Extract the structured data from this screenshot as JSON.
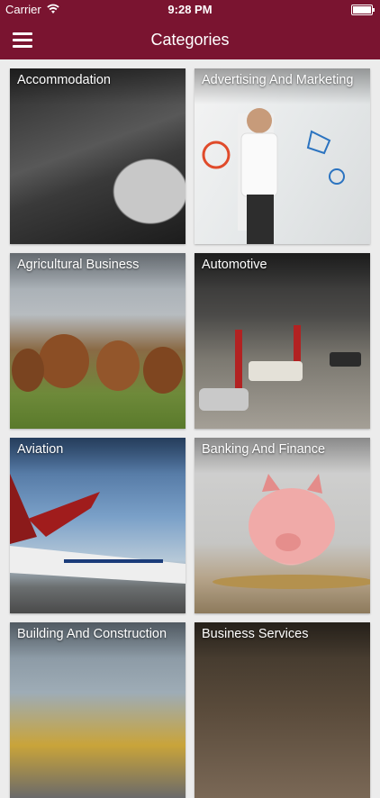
{
  "status_bar": {
    "carrier": "Carrier",
    "time": "9:28 PM"
  },
  "nav": {
    "title": "Categories",
    "menu_icon": "hamburger-menu-icon"
  },
  "categories": [
    {
      "label": "Accommodation"
    },
    {
      "label": "Advertising And Marketing"
    },
    {
      "label": "Agricultural Business"
    },
    {
      "label": "Automotive"
    },
    {
      "label": "Aviation"
    },
    {
      "label": "Banking And Finance"
    },
    {
      "label": "Building And Construction"
    },
    {
      "label": "Business Services"
    }
  ],
  "colors": {
    "brand": "#7a1430",
    "background": "#ececec"
  }
}
